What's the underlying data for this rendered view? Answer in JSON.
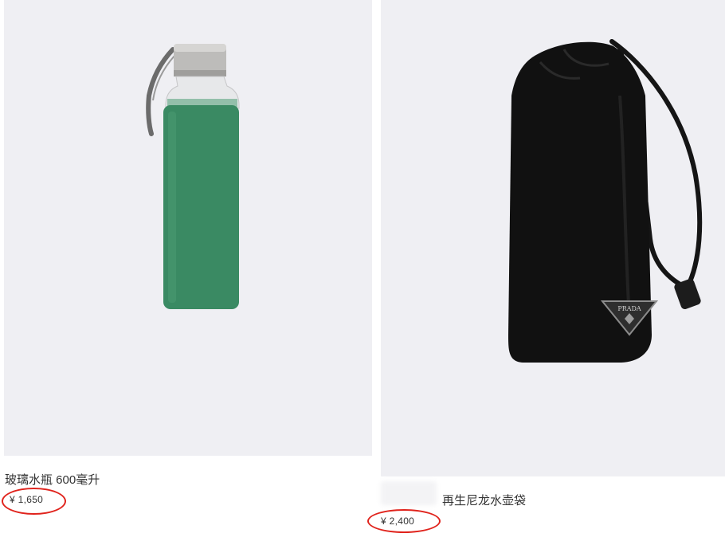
{
  "products": [
    {
      "name": "玻璃水瓶 600毫升",
      "price": "¥ 1,650",
      "bag_color": "#3a8a63",
      "cap_color": "#b7b6b4"
    },
    {
      "name": "再生尼龙水壶袋",
      "price": "¥ 2,400",
      "bag_color": "#111111",
      "logo_text": "PRADA"
    }
  ],
  "highlight_color": "#e0231c"
}
